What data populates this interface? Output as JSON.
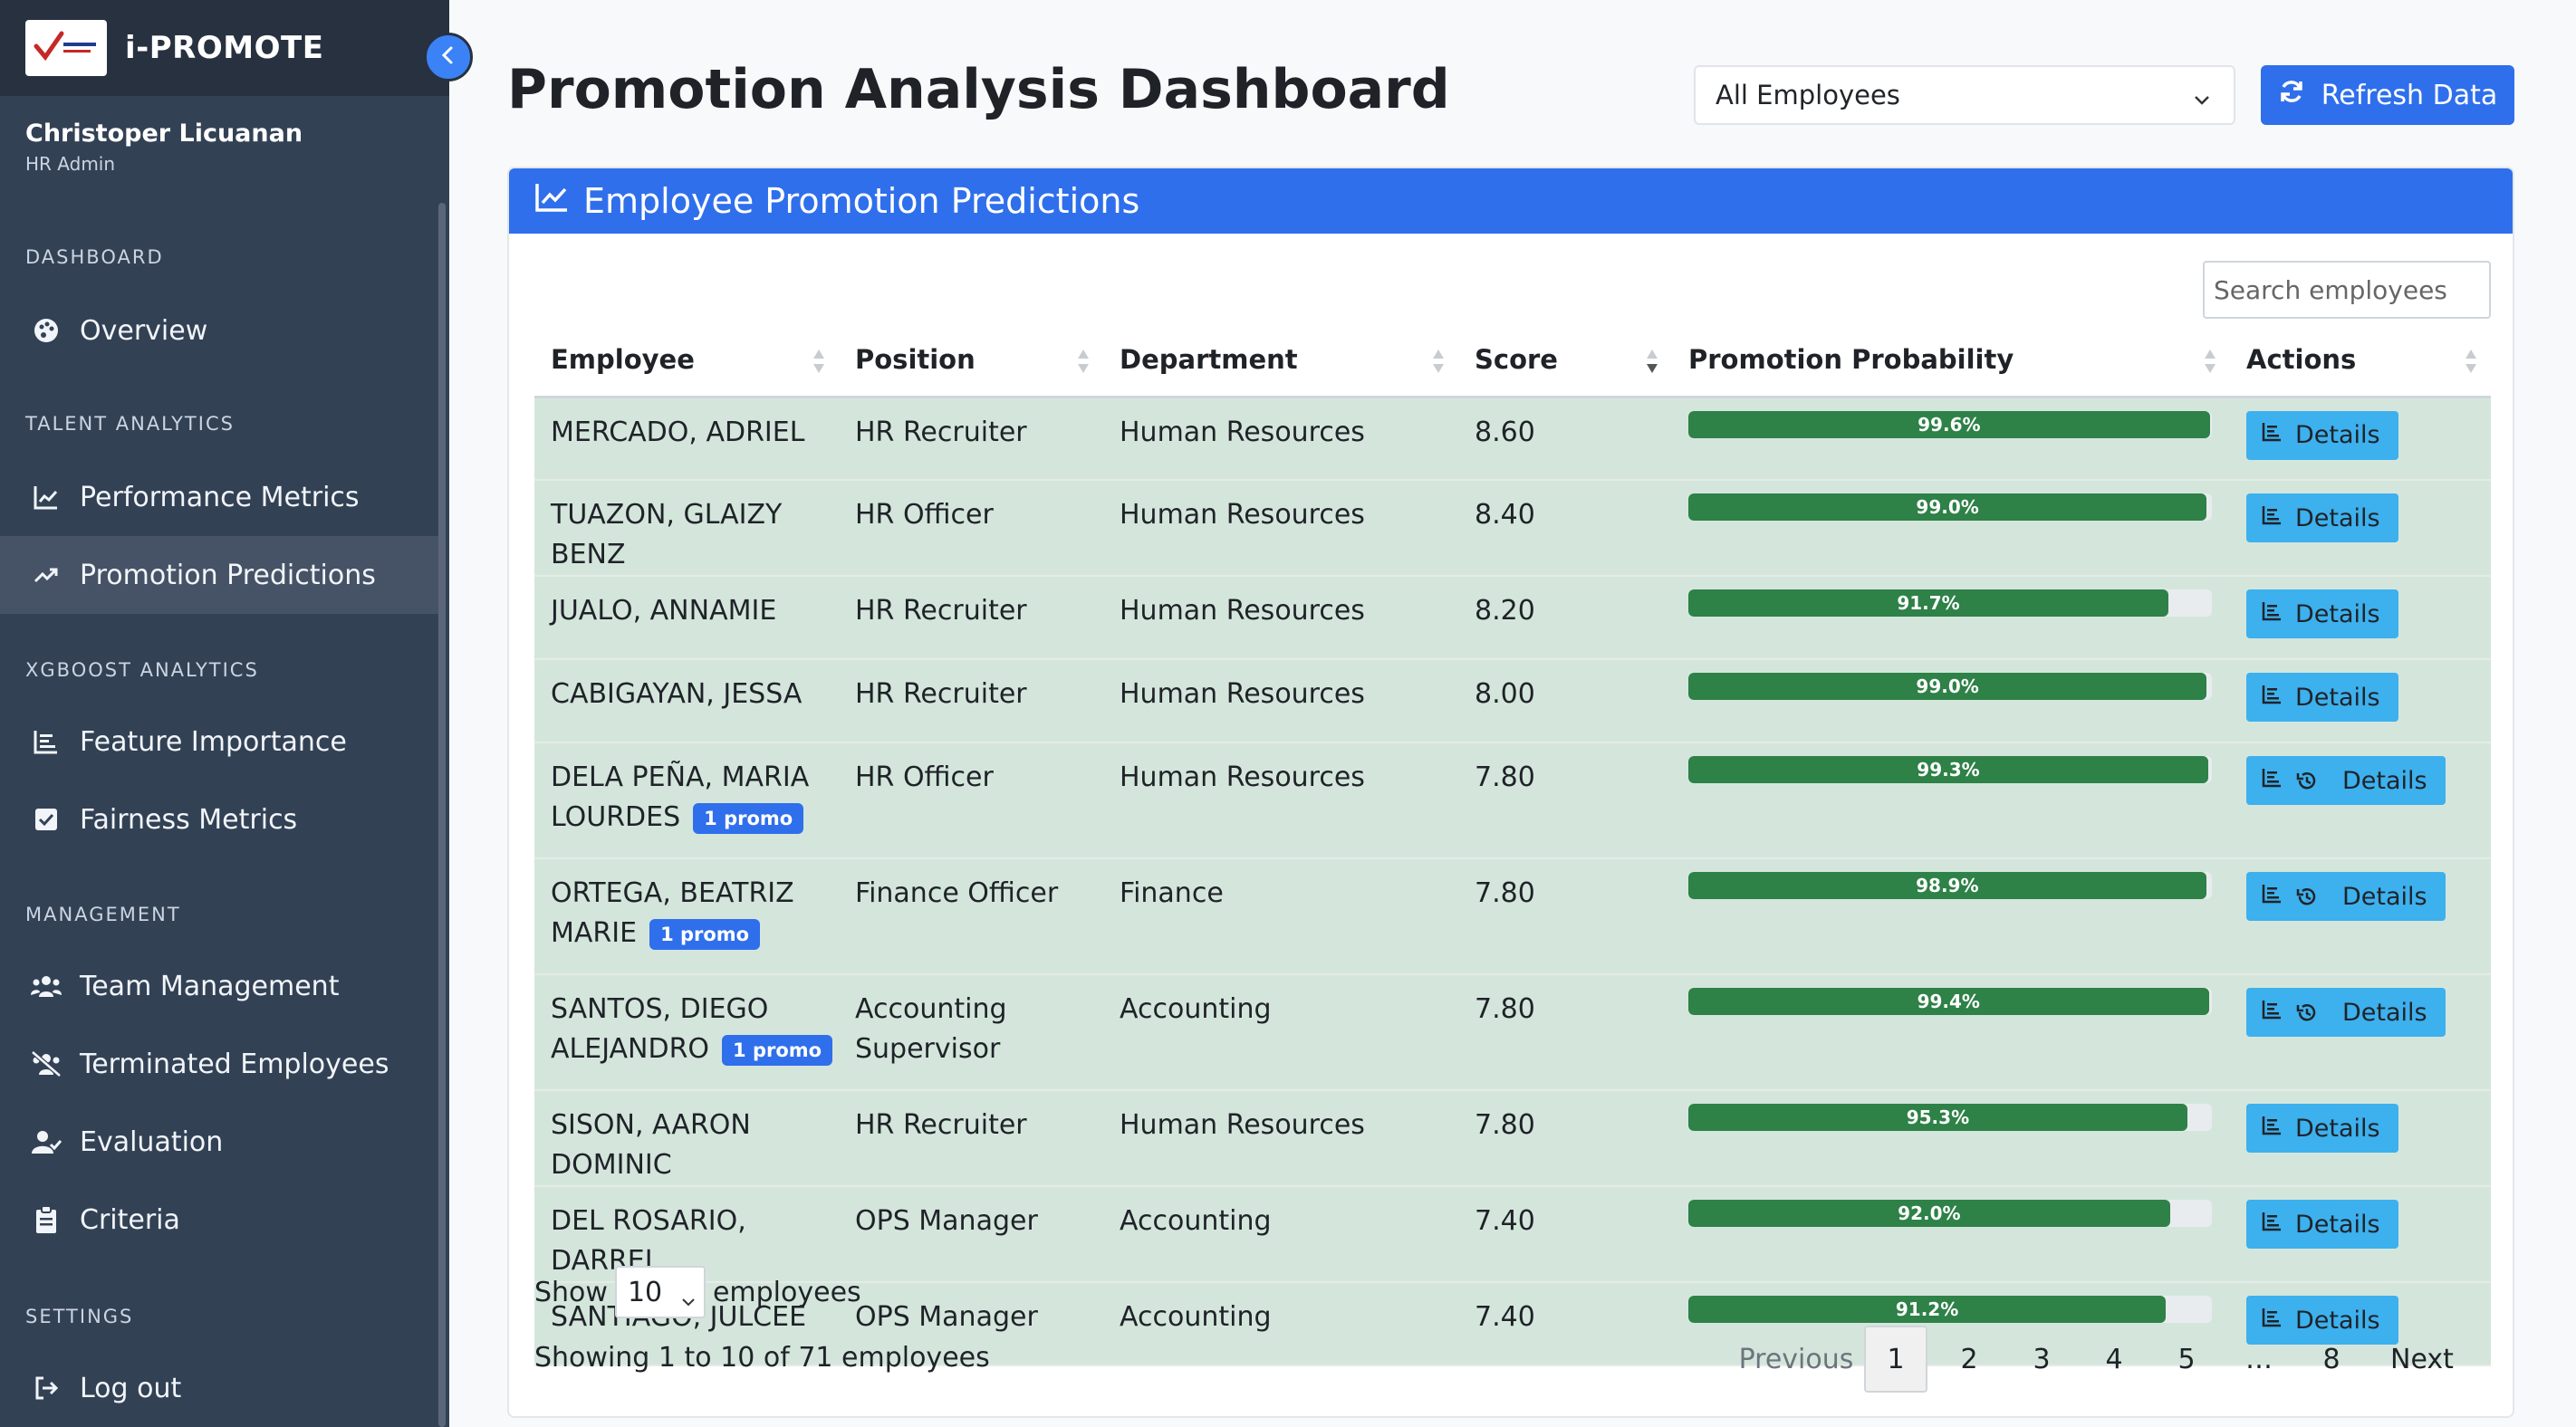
{
  "app": {
    "name": "i-PROMOTE"
  },
  "user": {
    "name": "Christoper Licuanan",
    "role": "HR Admin"
  },
  "sidebar": {
    "sections": [
      {
        "label": "DASHBOARD"
      },
      {
        "label": "TALENT ANALYTICS"
      },
      {
        "label": "XGBOOST ANALYTICS"
      },
      {
        "label": "MANAGEMENT"
      },
      {
        "label": "SETTINGS"
      }
    ],
    "items": [
      {
        "label": "Overview",
        "icon": "palette-icon"
      },
      {
        "label": "Performance Metrics",
        "icon": "line-chart-icon"
      },
      {
        "label": "Promotion Predictions",
        "icon": "trending-up-icon",
        "active": true
      },
      {
        "label": "Feature Importance",
        "icon": "bar-chart-icon"
      },
      {
        "label": "Fairness Metrics",
        "icon": "checkbox-icon"
      },
      {
        "label": "Team Management",
        "icon": "users-icon"
      },
      {
        "label": "Terminated Employees",
        "icon": "user-slash-icon"
      },
      {
        "label": "Evaluation",
        "icon": "user-check-icon"
      },
      {
        "label": "Criteria",
        "icon": "clipboard-icon"
      },
      {
        "label": "Log out",
        "icon": "logout-icon"
      }
    ]
  },
  "header": {
    "title": "Promotion Analysis Dashboard",
    "filter_value": "All Employees",
    "refresh_label": "Refresh Data"
  },
  "card": {
    "title": "Employee Promotion Predictions",
    "search_placeholder": "Search employees"
  },
  "table": {
    "columns": [
      "Employee",
      "Position",
      "Department",
      "Score",
      "Promotion Probability",
      "Actions"
    ],
    "rows": [
      {
        "name": "MERCADO, ADRIEL",
        "badge": "",
        "position": "HR Recruiter",
        "department": "Human Resources",
        "score": "8.60",
        "probability": 99.6,
        "probability_label": "99.6%",
        "action": "Details",
        "history": false
      },
      {
        "name": "TUAZON, GLAIZY BENZ",
        "badge": "",
        "position": "HR Officer",
        "department": "Human Resources",
        "score": "8.40",
        "probability": 99.0,
        "probability_label": "99.0%",
        "action": "Details",
        "history": false
      },
      {
        "name": "JUALO, ANNAMIE",
        "badge": "",
        "position": "HR Recruiter",
        "department": "Human Resources",
        "score": "8.20",
        "probability": 91.7,
        "probability_label": "91.7%",
        "action": "Details",
        "history": false
      },
      {
        "name": "CABIGAYAN, JESSA",
        "badge": "",
        "position": "HR Recruiter",
        "department": "Human Resources",
        "score": "8.00",
        "probability": 99.0,
        "probability_label": "99.0%",
        "action": "Details",
        "history": false
      },
      {
        "name": "DELA PEÑA, MARIA LOURDES",
        "badge": "1 promo",
        "position": "HR Officer",
        "department": "Human Resources",
        "score": "7.80",
        "probability": 99.3,
        "probability_label": "99.3%",
        "action": "Details",
        "history": true
      },
      {
        "name": "ORTEGA, BEATRIZ MARIE",
        "badge": "1 promo",
        "position": "Finance Officer",
        "department": "Finance",
        "score": "7.80",
        "probability": 98.9,
        "probability_label": "98.9%",
        "action": "Details",
        "history": true
      },
      {
        "name": "SANTOS, DIEGO ALEJANDRO",
        "badge": "1 promo",
        "position": "Accounting Supervisor",
        "department": "Accounting",
        "score": "7.80",
        "probability": 99.4,
        "probability_label": "99.4%",
        "action": "Details",
        "history": true
      },
      {
        "name": "SISON, AARON DOMINIC",
        "badge": "",
        "position": "HR Recruiter",
        "department": "Human Resources",
        "score": "7.80",
        "probability": 95.3,
        "probability_label": "95.3%",
        "action": "Details",
        "history": false
      },
      {
        "name": "DEL ROSARIO, DARREL",
        "badge": "",
        "position": "OPS Manager",
        "department": "Accounting",
        "score": "7.40",
        "probability": 92.0,
        "probability_label": "92.0%",
        "action": "Details",
        "history": false
      },
      {
        "name": "SANTIAGO, JULCEE",
        "badge": "",
        "position": "OPS Manager",
        "department": "Accounting",
        "score": "7.40",
        "probability": 91.2,
        "probability_label": "91.2%",
        "action": "Details",
        "history": false
      }
    ]
  },
  "footer": {
    "show_label": "Show",
    "page_size": "10",
    "show_suffix": "employees",
    "info": "Showing 1 to 10 of 71 employees",
    "pagination": {
      "previous": "Previous",
      "pages": [
        "1",
        "2",
        "3",
        "4",
        "5",
        "…",
        "8"
      ],
      "current": "1",
      "next": "Next"
    }
  },
  "colors": {
    "sidebar_bg": "#334155",
    "accent": "#2f6fec",
    "progress": "#2e8147",
    "row_highlight": "#d4e6dc",
    "details_button": "#3db0ee"
  }
}
